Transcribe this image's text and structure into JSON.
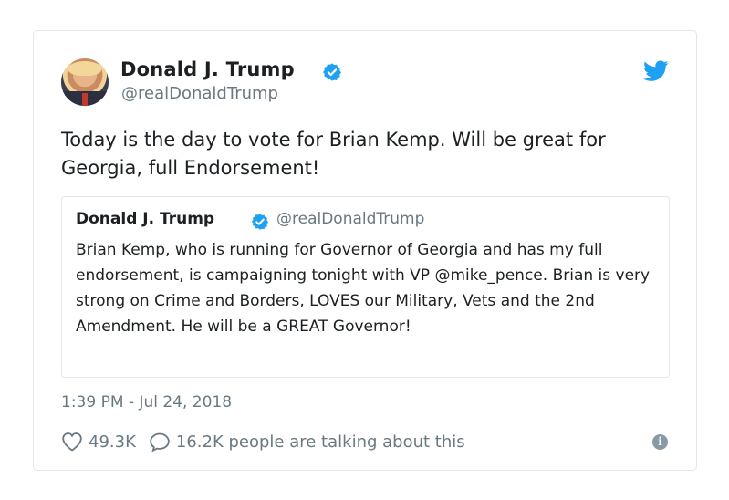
{
  "tweet": {
    "author_name": "Donald J. Trump",
    "author_handle": "@realDonaldTrump",
    "text": "Today is the day to vote for Brian Kemp. Will be great for Georgia, full Endorsement!",
    "timestamp": "1:39 PM - Jul 24, 2018",
    "likes": "49.3K",
    "talking": "16.2K people are talking about this",
    "icons": {
      "verified": "verified-badge-icon",
      "bird": "twitter-bird-icon",
      "heart": "heart-icon",
      "comment": "comment-bubble-icon",
      "info": "info-icon"
    }
  },
  "quoted_tweet": {
    "author_name": "Donald J. Trump",
    "author_handle": "@realDonaldTrump",
    "text": "Brian Kemp, who is running for Governor of Georgia and has my full endorsement, is campaigning tonight with VP @mike_pence. Brian is very strong on Crime and Borders, LOVES our Military, Vets and the 2nd Amendment. He will be a GREAT Governor!"
  },
  "colors": {
    "twitter_blue": "#1da1f2",
    "secondary_text": "#697882",
    "border": "#e1e8ed"
  }
}
